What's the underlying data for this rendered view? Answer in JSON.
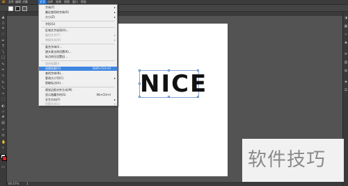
{
  "menubar": {
    "items": [
      "Ai",
      "文件",
      "编辑",
      "对象",
      "文字",
      "选择",
      "效果",
      "视图",
      "窗口",
      "帮助"
    ],
    "active_index": 4
  },
  "type_menu": {
    "items": [
      {
        "label": "字体(F)",
        "shortcut": "",
        "submenu": true,
        "disabled": false,
        "highlighted": false
      },
      {
        "label": "最近使用的字体(R)",
        "shortcut": "",
        "submenu": true,
        "disabled": false,
        "highlighted": false
      },
      {
        "label": "大小(Z)",
        "shortcut": "",
        "submenu": true,
        "disabled": false,
        "highlighted": false
      },
      {
        "label": "字形(G)",
        "shortcut": "",
        "submenu": false,
        "disabled": false,
        "highlighted": false
      },
      {
        "label": "区域文字选项(A)...",
        "shortcut": "",
        "submenu": false,
        "disabled": false,
        "highlighted": false
      },
      {
        "label": "路径文字(T)",
        "shortcut": "",
        "submenu": true,
        "disabled": true,
        "highlighted": false
      },
      {
        "label": "串接文本(H)",
        "shortcut": "",
        "submenu": true,
        "disabled": true,
        "highlighted": false
      },
      {
        "label": "复合字体(I)...",
        "shortcut": "",
        "submenu": false,
        "disabled": false,
        "highlighted": false
      },
      {
        "label": "避头尾法则设置(K)...",
        "shortcut": "",
        "submenu": false,
        "disabled": false,
        "highlighted": false
      },
      {
        "label": "标点挤压设置(J)...",
        "shortcut": "",
        "submenu": false,
        "disabled": false,
        "highlighted": false
      },
      {
        "label": "适合标题(I)",
        "shortcut": "",
        "submenu": false,
        "disabled": true,
        "highlighted": false
      },
      {
        "label": "创建轮廓(O)",
        "shortcut": "Shift+Ctrl+O",
        "submenu": false,
        "disabled": false,
        "highlighted": true
      },
      {
        "label": "查找字体(N)...",
        "shortcut": "",
        "submenu": false,
        "disabled": false,
        "highlighted": false
      },
      {
        "label": "更改大小写(C)",
        "shortcut": "",
        "submenu": true,
        "disabled": false,
        "highlighted": false
      },
      {
        "label": "智能标点(U)...",
        "shortcut": "",
        "submenu": false,
        "disabled": false,
        "highlighted": false
      },
      {
        "label": "视觉边距对齐方式(M)",
        "shortcut": "",
        "submenu": false,
        "disabled": false,
        "highlighted": false
      },
      {
        "label": "显示隐藏字符(S)",
        "shortcut": "Alt+Ctrl+I",
        "submenu": false,
        "disabled": false,
        "highlighted": false
      },
      {
        "label": "文字方向(Y)",
        "shortcut": "",
        "submenu": true,
        "disabled": false,
        "highlighted": false
      },
      {
        "label": "旧版文本(L)",
        "shortcut": "",
        "submenu": true,
        "disabled": true,
        "highlighted": false
      }
    ]
  },
  "canvas": {
    "text": "NICE"
  },
  "statusbar": {
    "zoom": "66.67%",
    "page": "1"
  },
  "watermark": {
    "text": "软件技巧"
  },
  "colors": {
    "highlight": "#3f86e0",
    "fill": "#ffffff",
    "stroke": "#e02020"
  }
}
